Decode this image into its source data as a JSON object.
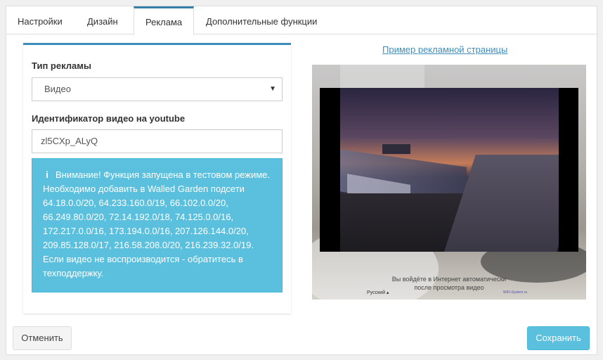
{
  "tabs": [
    {
      "label": "Настройки"
    },
    {
      "label": "Дизайн"
    },
    {
      "label": "Реклама"
    },
    {
      "label": "Дополнительные функции"
    }
  ],
  "active_tab": "Реклама",
  "form": {
    "ad_type_label": "Тип рекламы",
    "ad_type_value": "Видео",
    "video_id_label": "Идентификатор видео на youtube",
    "video_id_value": "zl5CXp_ALyQ"
  },
  "alert": {
    "icon": "info-icon",
    "lines": [
      "Внимание! Функция запущена в тестовом режиме.",
      "Необходимо добавить в Walled Garden подсети",
      "64.18.0.0/20, 64.233.160.0/19, 66.102.0.0/20,",
      "66.249.80.0/20, 72.14.192.0/18, 74.125.0.0/16,",
      "172.217.0.0/16, 173.194.0.0/16, 207.126.144.0/20,",
      "209.85.128.0/17, 216.58.208.0/20, 216.239.32.0/19.",
      "Если видео не воспроизводится - обратитесь в",
      "техподдержку."
    ]
  },
  "preview": {
    "link_label": "Пример рекламной страницы",
    "caption_line1": "Вы войдёте в Интернет автоматически",
    "caption_line2": "после просмотра видео",
    "language": "Русский ▴",
    "brand": "WiFi-System.ru"
  },
  "buttons": {
    "cancel": "Отменить",
    "save": "Сохранить"
  },
  "colors": {
    "accent": "#3c8dbc",
    "info": "#5bc0de"
  }
}
